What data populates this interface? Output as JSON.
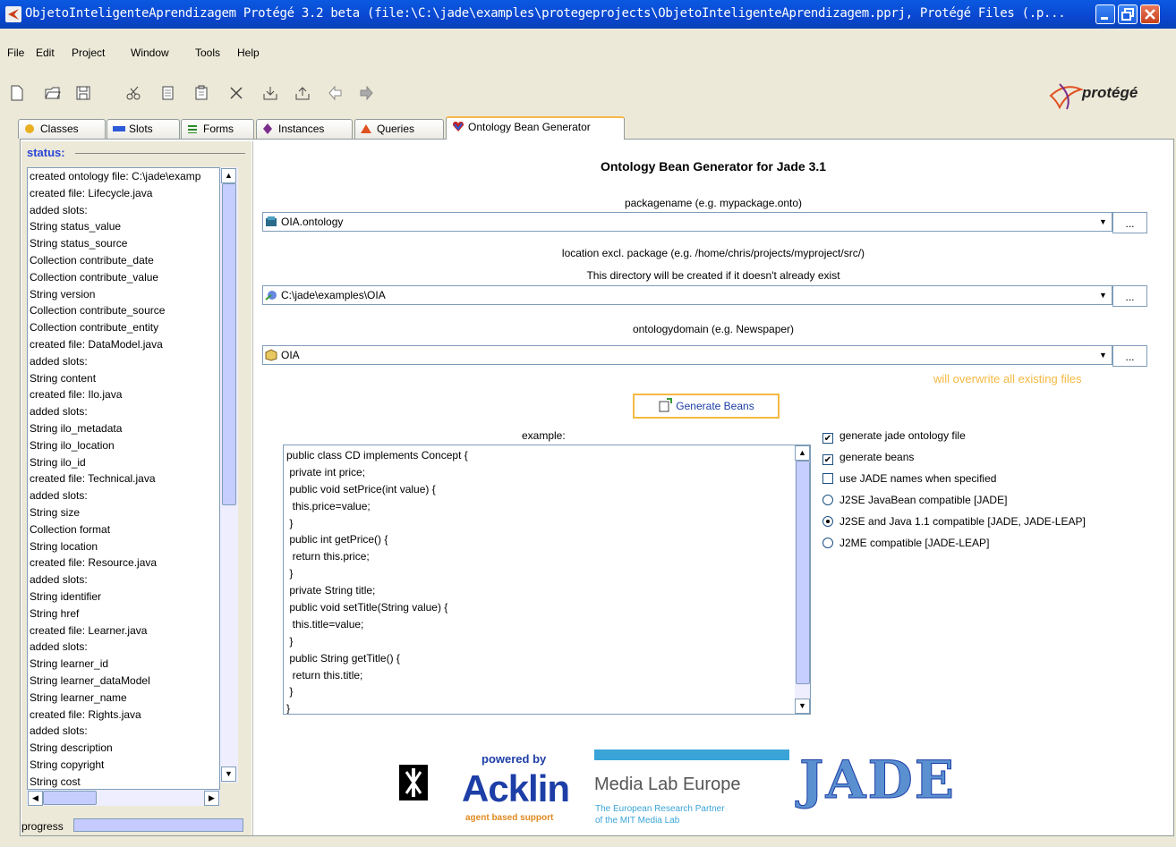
{
  "window": {
    "title": "ObjetoInteligenteAprendizagem  Protégé 3.2 beta   (file:\\C:\\jade\\examples\\protegeprojects\\ObjetoInteligenteAprendizagem.pprj, Protégé Files (.p..."
  },
  "menu": [
    "File",
    "Edit",
    "Project",
    "Window",
    "Tools",
    "Help"
  ],
  "toolbar": {
    "icons": [
      "new-file-icon",
      "open-folder-icon",
      "save-icon",
      "cut-icon",
      "copy-icon",
      "paste-icon",
      "delete-icon",
      "import-icon",
      "export-icon",
      "undo-icon",
      "redo-icon"
    ],
    "logo_text": "protégé"
  },
  "tabs": [
    {
      "label": "Classes",
      "icon": "classes-icon",
      "color": "#e8b020"
    },
    {
      "label": "Slots",
      "icon": "slots-icon",
      "color": "#2c5ad8"
    },
    {
      "label": "Forms",
      "icon": "forms-icon",
      "color": "#2a8a2a"
    },
    {
      "label": "Instances",
      "icon": "instances-icon",
      "color": "#7a2f8a"
    },
    {
      "label": "Queries",
      "icon": "queries-icon",
      "color": "#e05020"
    },
    {
      "label": "Ontology Bean Generator",
      "icon": "ontology-bean-icon",
      "color": "#c02020"
    }
  ],
  "status": {
    "label": "status:",
    "lines": [
      "created ontology file: C:\\jade\\examp",
      " created file: Lifecycle.java",
      "  added slots:",
      "    String status_value",
      "    String status_source",
      "Collection contribute_date",
      "Collection contribute_value",
      "    String version",
      "Collection contribute_source",
      "Collection contribute_entity",
      " created file: DataModel.java",
      "  added slots:",
      "    String content",
      " created file: Ilo.java",
      "  added slots:",
      "    String ilo_metadata",
      "    String ilo_location",
      "    String ilo_id",
      " created file: Technical.java",
      "  added slots:",
      "    String size",
      "Collection format",
      "    String location",
      " created file: Resource.java",
      "  added slots:",
      "    String identifier",
      "    String href",
      " created file: Learner.java",
      "  added slots:",
      "    String learner_id",
      "    String learner_dataModel",
      "    String learner_name",
      " created file: Rights.java",
      "  added slots:",
      "    String description",
      "    String copyright",
      "    String cost"
    ],
    "progress_label": "progress"
  },
  "generator": {
    "heading": "Ontology Bean Generator for Jade 3.1",
    "package_caption": "packagename (e.g. mypackage.onto)",
    "package_value": "OIA.ontology",
    "location_caption": "location excl. package (e.g. /home/chris/projects/myproject/src/)",
    "location_note": "This directory will be created if it doesn't already exist",
    "location_value": "C:\\jade\\examples\\OIA",
    "domain_caption": "ontologydomain (e.g. Newspaper)",
    "domain_value": "OIA",
    "browse_label": "...",
    "warning": "will overwrite all existing files",
    "warning_color": "#f5b942",
    "generate_button": "Generate Beans",
    "example_label": "example:",
    "example_code": [
      "public class CD implements Concept {",
      " private int price;",
      " public void setPrice(int value) {",
      "  this.price=value;",
      " }",
      " public int getPrice() {",
      "  return this.price;",
      " }",
      " private String title;",
      " public void setTitle(String value) {",
      "  this.title=value;",
      " }",
      " public String getTitle() {",
      "  return this.title;",
      " }",
      "}"
    ],
    "options": {
      "gen_ontology_file": {
        "label": "generate jade ontology file",
        "checked": true
      },
      "gen_beans": {
        "label": "generate beans",
        "checked": true
      },
      "use_jade_names": {
        "label": "use JADE names when specified",
        "checked": false
      },
      "j2se_javabean": {
        "label": "J2SE JavaBean compatible [JADE]",
        "selected": false
      },
      "j2se_java11": {
        "label": "J2SE and Java 1.1 compatible [JADE, JADE-LEAP]",
        "selected": true
      },
      "j2me": {
        "label": "J2ME compatible [JADE-LEAP]",
        "selected": false
      }
    }
  },
  "footer": {
    "powered_by": "powered by",
    "acklin": "Acklin",
    "acklin_tag": "agent based support",
    "medialab": "Media Lab Europe",
    "medialab_sub1": "The European Research Partner",
    "medialab_sub2": "of the MIT Media Lab",
    "jade": "JADE"
  }
}
